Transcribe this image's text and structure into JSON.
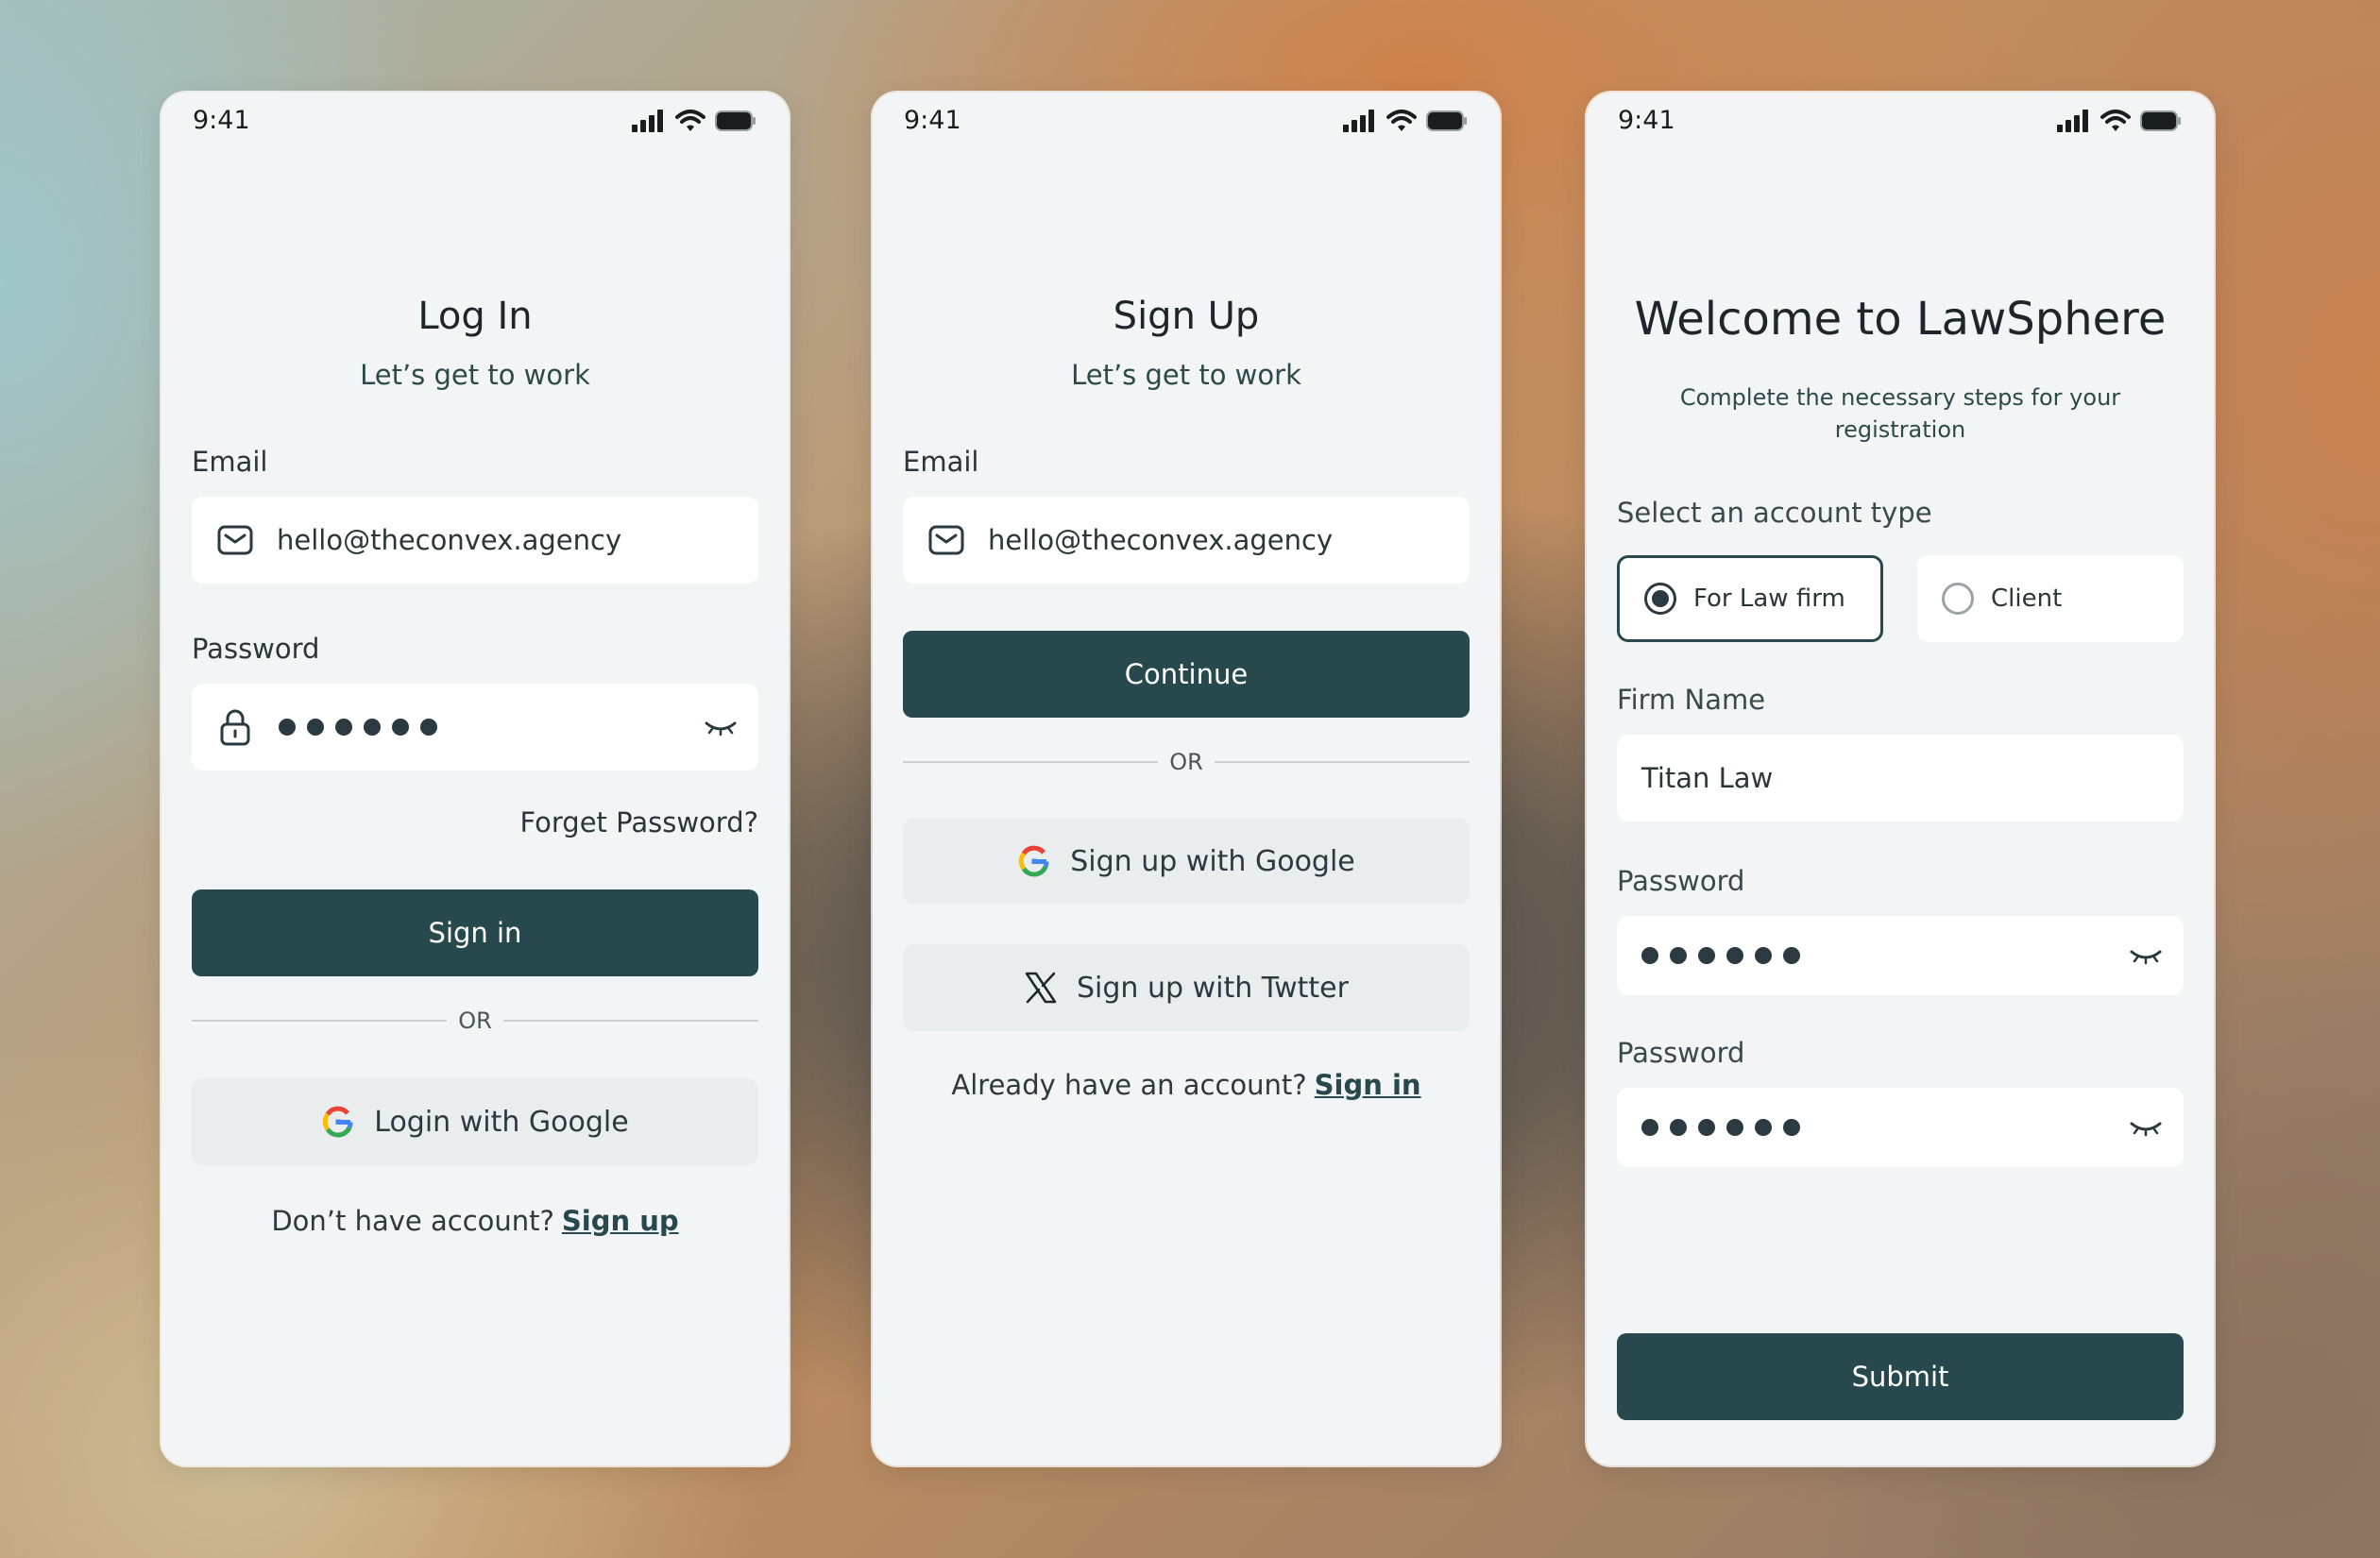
{
  "status": {
    "time": "9:41"
  },
  "login": {
    "title": "Log In",
    "subtitle": "Let’s get to work",
    "email_label": "Email",
    "email_value": "hello@theconvex.agency",
    "password_label": "Password",
    "forgot": "Forget Password?",
    "signin_label": "Sign in",
    "or": "OR",
    "google_label": "Login with Google",
    "footer_text": "Don’t have account?",
    "footer_link": "Sign up"
  },
  "signup": {
    "title": "Sign Up",
    "subtitle": "Let’s get to work",
    "email_label": "Email",
    "email_value": "hello@theconvex.agency",
    "continue_label": "Continue",
    "or": "OR",
    "google_label": "Sign up with Google",
    "twitter_label": "Sign up with Twtter",
    "footer_text": "Already have an account?",
    "footer_link": "Sign in"
  },
  "welcome": {
    "title": "Welcome to LawSphere",
    "subtitle": "Complete the necessary steps for your registration",
    "account_type_label": "Select an account type",
    "option_lawfirm": "For Law firm",
    "option_client": "Client",
    "firm_name_label": "Firm Name",
    "firm_name_value": "Titan Law",
    "password_label": "Password",
    "password2_label": "Password",
    "submit_label": "Submit"
  },
  "colors": {
    "primary": "#27484c",
    "card_bg": "#f2f4f5",
    "field_bg": "#ffffff",
    "social_bg": "#e9eded"
  }
}
